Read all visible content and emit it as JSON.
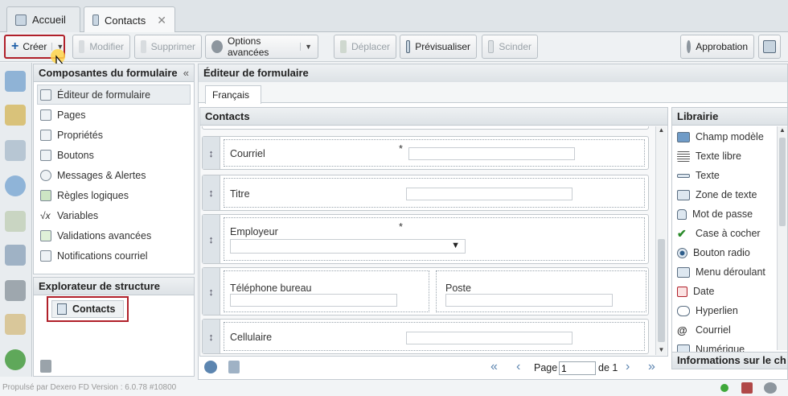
{
  "tabs": [
    {
      "label": "Accueil"
    },
    {
      "label": "Contacts"
    }
  ],
  "toolbar": {
    "create": "Créer",
    "modify": "Modifier",
    "delete": "Supprimer",
    "advanced": "Options avancées",
    "move": "Déplacer",
    "preview": "Prévisualiser",
    "split": "Scinder",
    "approval": "Approbation"
  },
  "components": {
    "title": "Composantes du formulaire",
    "items": [
      {
        "label": "Éditeur de formulaire"
      },
      {
        "label": "Pages"
      },
      {
        "label": "Propriétés"
      },
      {
        "label": "Boutons"
      },
      {
        "label": "Messages & Alertes"
      },
      {
        "label": "Règles logiques"
      },
      {
        "label": "Variables"
      },
      {
        "label": "Validations avancées"
      },
      {
        "label": "Notifications courriel"
      }
    ]
  },
  "explorer": {
    "title": "Explorateur de structure",
    "node": "Contacts"
  },
  "editor": {
    "title": "Éditeur de formulaire",
    "lang_tab": "Français",
    "section": "Contacts",
    "fields": {
      "courriel": "Courriel",
      "titre": "Titre",
      "employeur": "Employeur",
      "tel": "Téléphone bureau",
      "poste": "Poste",
      "cell": "Cellulaire"
    },
    "required_mark": "*"
  },
  "library": {
    "title": "Librairie",
    "items": [
      {
        "label": "Champ modèle"
      },
      {
        "label": "Texte libre"
      },
      {
        "label": "Texte"
      },
      {
        "label": "Zone de texte"
      },
      {
        "label": "Mot de passe"
      },
      {
        "label": "Case à cocher"
      },
      {
        "label": "Bouton radio"
      },
      {
        "label": "Menu déroulant"
      },
      {
        "label": "Date"
      },
      {
        "label": "Hyperlien"
      },
      {
        "label": "Courriel"
      },
      {
        "label": "Numérique"
      }
    ],
    "info_title": "Informations sur le ch"
  },
  "pager": {
    "page_label": "Page",
    "page_value": "1",
    "of_label": "de 1"
  },
  "footer": {
    "text": "Propulsé par Dexero FD Version : 6.0.78 #10800"
  },
  "colors": {
    "accent_red": "#b0202a"
  }
}
